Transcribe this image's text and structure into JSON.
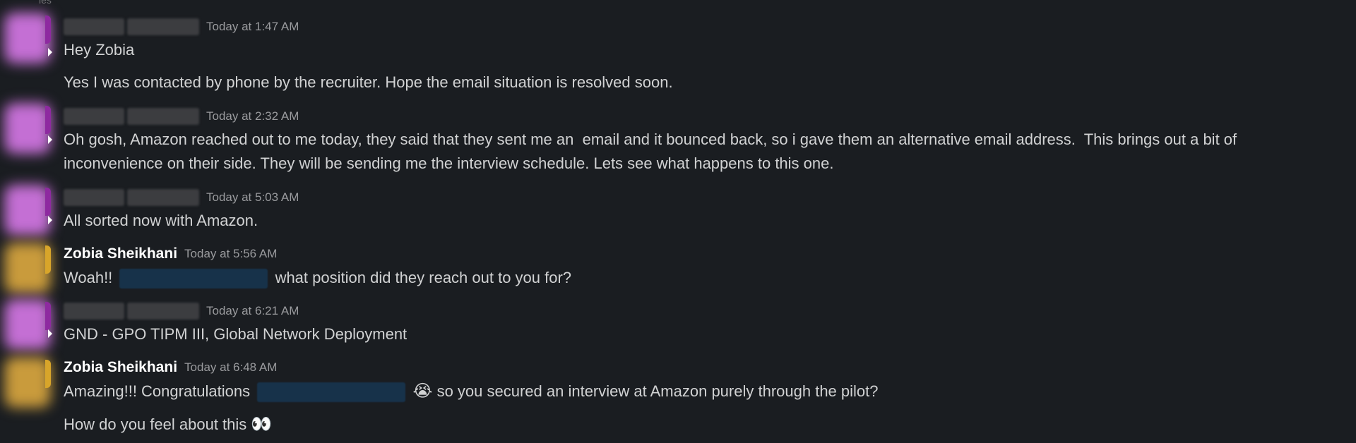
{
  "top_partial": "ies",
  "messages": [
    {
      "sender": "",
      "time": "Today at 1:47 AM",
      "lines": [
        "Hey Zobia",
        "Yes I was contacted by phone by the recruiter. Hope the email situation is resolved soon."
      ]
    },
    {
      "sender": "",
      "time": "Today at 2:32 AM",
      "lines": [
        "Oh gosh, Amazon reached out to me today, they said that they sent me an  email and it bounced back, so i gave them an alternative email address.  This brings out a bit of inconvenience on their side. They will be sending me the interview schedule. Lets see what happens to this one."
      ]
    },
    {
      "sender": "",
      "time": "Today at 5:03 AM",
      "lines": [
        "All sorted now with Amazon."
      ]
    },
    {
      "sender": "Zobia Sheikhani",
      "time": "Today at 5:56 AM",
      "line_before_mention": "Woah!!",
      "line_after_mention": "what position did they reach out to you for?"
    },
    {
      "sender": "",
      "time": "Today at 6:21 AM",
      "lines": [
        "GND - GPO TIPM III, Global Network Deployment"
      ]
    },
    {
      "sender": "Zobia Sheikhani",
      "time": "Today at 6:48 AM",
      "line_before_mention": "Amazing!!! Congratulations",
      "emoji_crying": "😭",
      "line_after_mention": "so you secured an interview at Amazon purely through the pilot?",
      "line2": "How do you feel about this",
      "emoji_eyes": "👀"
    }
  ],
  "colors": {
    "background": "#1a1d21",
    "avatar_purple": "#c46fd4",
    "avatar_gold": "#c99b3c",
    "mention_bg": "#17324a"
  }
}
